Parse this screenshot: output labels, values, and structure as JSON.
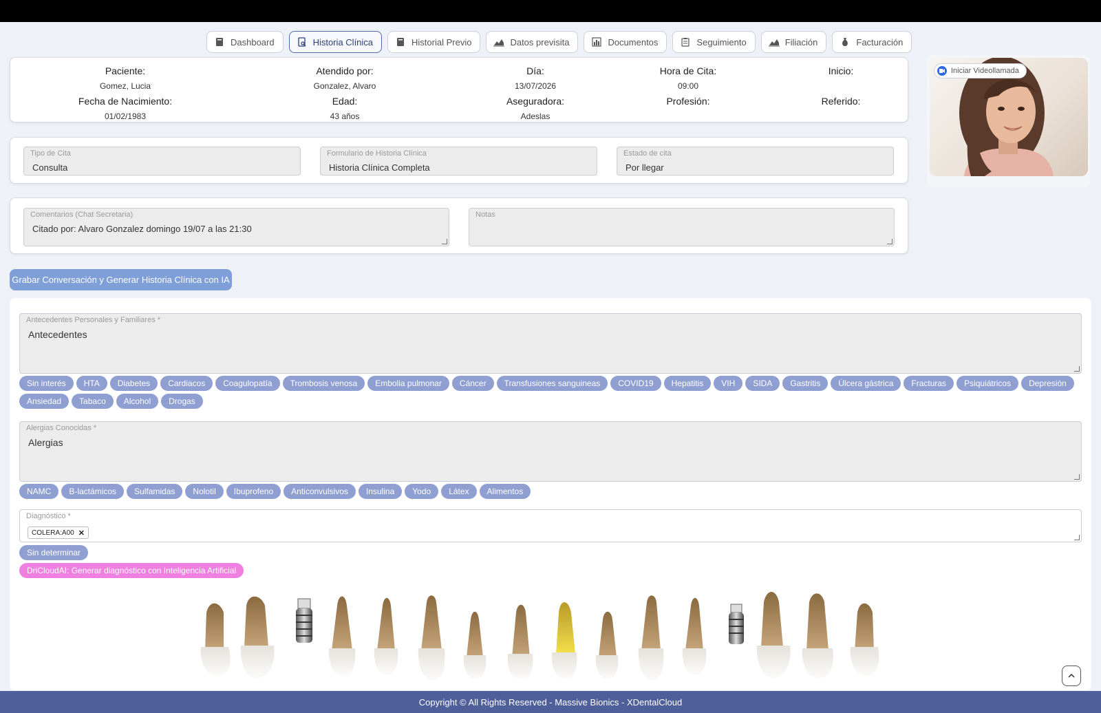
{
  "tabs": [
    {
      "label": "Dashboard",
      "icon": "notebook-icon",
      "active": false
    },
    {
      "label": "Historia Clínica",
      "icon": "document-search-icon",
      "active": true
    },
    {
      "label": "Historial Previo",
      "icon": "notebook-icon",
      "active": false
    },
    {
      "label": "Datos previsita",
      "icon": "chart-icon",
      "active": false
    },
    {
      "label": "Documentos",
      "icon": "bar-chart-icon",
      "active": false
    },
    {
      "label": "Seguimiento",
      "icon": "clipboard-icon",
      "active": false
    },
    {
      "label": "Filiación",
      "icon": "chart-icon",
      "active": false
    },
    {
      "label": "Facturación",
      "icon": "money-bag-icon",
      "active": false
    }
  ],
  "patient": {
    "paciente_label": "Paciente:",
    "paciente": "Gomez, Lucia",
    "atendido_label": "Atendido por:",
    "atendido": "Gonzalez, Alvaro",
    "dia_label": "Día:",
    "dia": "13/07/2026",
    "hora_label": "Hora de Cita:",
    "hora": "09:00",
    "inicio_label": "Inicio:",
    "nacimiento_label": "Fecha de Nacimiento:",
    "nacimiento": "01/02/1983",
    "edad_label": "Edad:",
    "edad": "43 años",
    "aseguradora_label": "Aseguradora:",
    "aseguradora": "Adeslas",
    "profesion_label": "Profesión:",
    "referido_label": "Referido:"
  },
  "video": {
    "label": "Iniciar Videollamada"
  },
  "cita": {
    "tipo_label": "Tipo de Cita",
    "tipo": "Consulta",
    "formulario_label": "Formulario de Historia Clínica",
    "formulario": "Historia Clínica Completa",
    "estado_label": "Estado de cita",
    "estado": "Por llegar"
  },
  "comments": {
    "comentarios_label": "Comentarios (Chat Secretaria)",
    "comentarios": "Citado por: Alvaro Gonzalez domingo 19/07 a las 21:30",
    "notas_label": "Notas"
  },
  "ai_button": "Grabar Conversación y Generar Historia Clínica con IA",
  "antecedentes": {
    "label": "Antecedentes Personales y Familiares *",
    "value": "Antecedentes",
    "chips": [
      "Sin interés",
      "HTA",
      "Diabetes",
      "Cardiacos",
      "Coagulopatía",
      "Trombosis venosa",
      "Embolia pulmonar",
      "Cáncer",
      "Transfusiones sanguineas",
      "COVID19",
      "Hepatitis",
      "VIH",
      "SIDA",
      "Gastritis",
      "Úlcera gástrica",
      "Fracturas",
      "Psiquiátricos",
      "Depresión",
      "Ansiedad",
      "Tabaco",
      "Alcohol",
      "Drogas"
    ]
  },
  "alergias": {
    "label": "Alergias Conocidas *",
    "value": "Alergias",
    "chips": [
      "NAMC",
      "B-lactámicos",
      "Sulfamidas",
      "Nolotil",
      "Ibuprofeno",
      "Anticonvulsivos",
      "Insulina",
      "Yodo",
      "Látex",
      "Alimentos"
    ]
  },
  "diagnostico": {
    "label": "Diagnóstico *",
    "tag": "COLERA:A00",
    "sin_determinar": "Sin determinar",
    "ai_diag": "DriCloudAI: Generar diagnóstico con Inteligencia Artificial"
  },
  "footer": "Copyright © All Rights Reserved - Massive Bionics - XDentalCloud",
  "colors": {
    "chip": "#8f9fd2",
    "pink_chip": "#ef7fe0",
    "footer": "#4e5f99",
    "ai_button": "#7f9fd8"
  }
}
